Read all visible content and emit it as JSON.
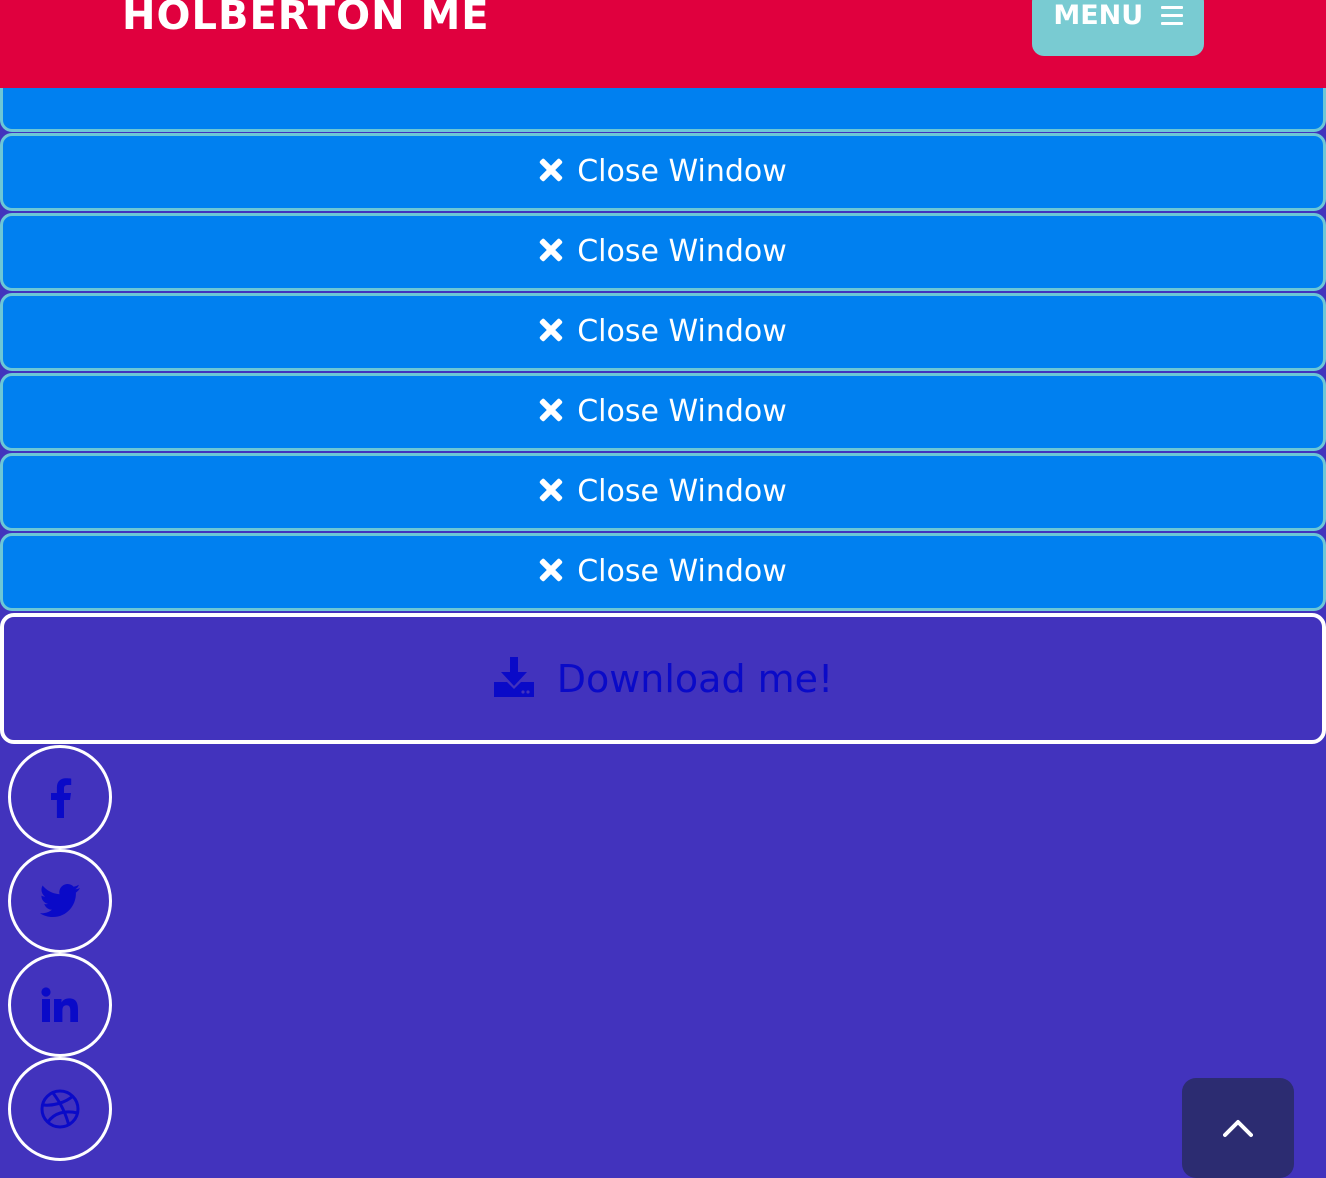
{
  "header": {
    "brand": "HOLBERTON ME",
    "menu_label": "MENU",
    "menu_icon": "hamburger-icon"
  },
  "windows": [
    {
      "label": "Close Window",
      "icon": "close-icon"
    },
    {
      "label": "Close Window",
      "icon": "close-icon"
    },
    {
      "label": "Close Window",
      "icon": "close-icon"
    },
    {
      "label": "Close Window",
      "icon": "close-icon"
    },
    {
      "label": "Close Window",
      "icon": "close-icon"
    },
    {
      "label": "Close Window",
      "icon": "close-icon"
    }
  ],
  "download": {
    "label": "Download me!",
    "icon": "download-icon"
  },
  "social": [
    {
      "icon": "facebook-icon"
    },
    {
      "icon": "twitter-icon"
    },
    {
      "icon": "linkedin-icon"
    },
    {
      "icon": "dribbble-icon"
    }
  ],
  "back_to_top": {
    "icon": "chevron-up-icon"
  },
  "colors": {
    "header": "#e0003e",
    "menu_button": "#79cbd2",
    "window_bar": "#0080f0",
    "window_border": "#6cc7d6",
    "page_background": "#4233bd",
    "download_text": "#0a0ac8",
    "back_to_top": "#2c2c71"
  }
}
